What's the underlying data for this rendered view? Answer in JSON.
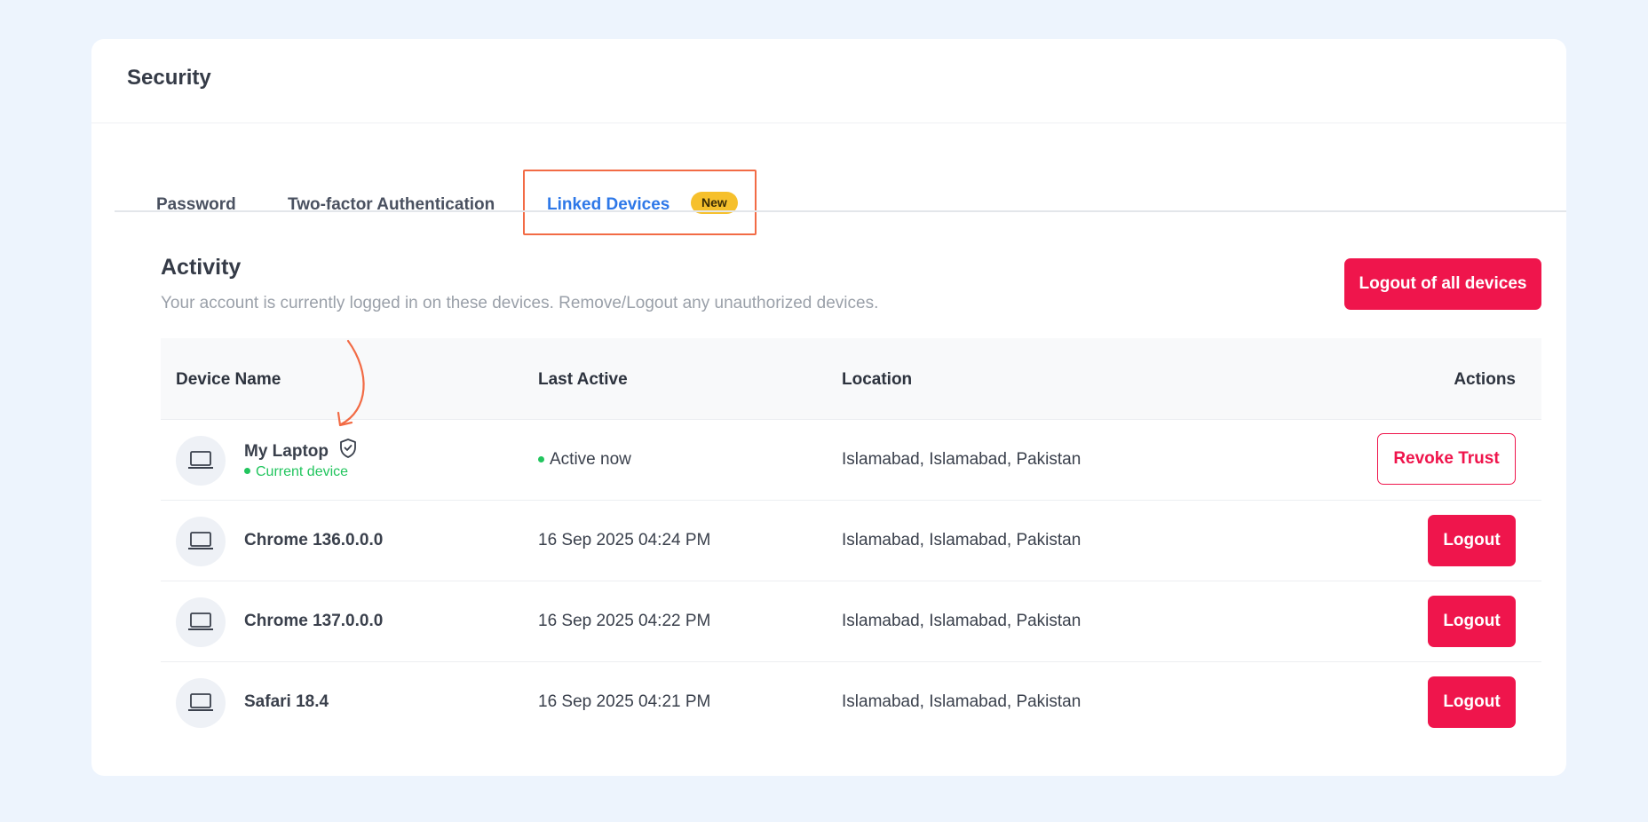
{
  "header": {
    "title": "Security"
  },
  "tabs": {
    "password": "Password",
    "two_factor": "Two-factor Authentication",
    "linked_devices": "Linked Devices",
    "badge": "New"
  },
  "activity": {
    "title": "Activity",
    "description": "Your account is currently logged in on these devices. Remove/Logout any unauthorized devices.",
    "logout_all_label": "Logout of all devices"
  },
  "table": {
    "headers": {
      "device": "Device Name",
      "last_active": "Last Active",
      "location": "Location",
      "actions": "Actions"
    },
    "rows": [
      {
        "device": "My Laptop",
        "current_label": "Current device",
        "last_active": "Active now",
        "location": "Islamabad, Islamabad, Pakistan",
        "action": "Revoke Trust"
      },
      {
        "device": "Chrome 136.0.0.0",
        "last_active": "16 Sep 2025 04:24 PM",
        "location": "Islamabad, Islamabad, Pakistan",
        "action": "Logout"
      },
      {
        "device": "Chrome 137.0.0.0",
        "last_active": "16 Sep 2025 04:22 PM",
        "location": "Islamabad, Islamabad, Pakistan",
        "action": "Logout"
      },
      {
        "device": "Safari 18.4",
        "last_active": "16 Sep 2025 04:21 PM",
        "location": "Islamabad, Islamabad, Pakistan",
        "action": "Logout"
      }
    ]
  },
  "icons": {
    "device": "laptop-icon",
    "trusted": "shield-check-icon",
    "annotation": "curved-arrow-icon"
  },
  "colors": {
    "background": "#edf4fd",
    "accent_blue": "#2e78e8",
    "danger": "#ef154c",
    "badge": "#f6c02c",
    "highlight_box": "#f26b45",
    "success": "#22c55e"
  }
}
